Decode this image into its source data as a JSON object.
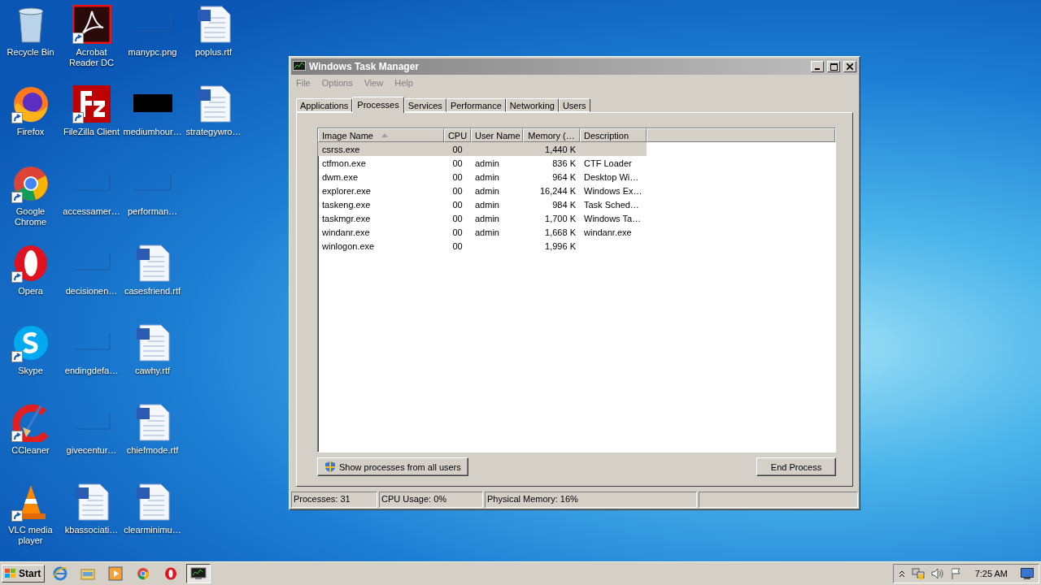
{
  "desktop": {
    "icons": [
      {
        "label": "Recycle Bin",
        "kind": "recycle",
        "shortcut": false
      },
      {
        "label": "Firefox",
        "kind": "firefox",
        "shortcut": true
      },
      {
        "label": "Google Chrome",
        "kind": "chrome",
        "shortcut": true
      },
      {
        "label": "Opera",
        "kind": "opera",
        "shortcut": true
      },
      {
        "label": "Skype",
        "kind": "skype",
        "shortcut": true
      },
      {
        "label": "CCleaner",
        "kind": "ccleaner",
        "shortcut": true
      },
      {
        "label": "VLC media player",
        "kind": "vlc",
        "shortcut": true
      },
      {
        "label": "Acrobat Reader DC",
        "kind": "acrobat",
        "shortcut": true
      },
      {
        "label": "FileZilla Client",
        "kind": "filezilla",
        "shortcut": true
      },
      {
        "label": "accessamer…",
        "kind": "blank",
        "shortcut": false
      },
      {
        "label": "decisionen…",
        "kind": "blank",
        "shortcut": false
      },
      {
        "label": "endingdefa…",
        "kind": "blank",
        "shortcut": false
      },
      {
        "label": "givecentur…",
        "kind": "blank",
        "shortcut": false
      },
      {
        "label": "kbassociati…",
        "kind": "word",
        "shortcut": false
      },
      {
        "label": "manypc.png",
        "kind": "blank",
        "shortcut": false
      },
      {
        "label": "mediumhour…",
        "kind": "black",
        "shortcut": false
      },
      {
        "label": "performan…",
        "kind": "blank",
        "shortcut": false
      },
      {
        "label": "casesfriend.rtf",
        "kind": "word",
        "shortcut": false
      },
      {
        "label": "cawhy.rtf",
        "kind": "word",
        "shortcut": false
      },
      {
        "label": "chiefmode.rtf",
        "kind": "word",
        "shortcut": false
      },
      {
        "label": "clearminimu…",
        "kind": "word",
        "shortcut": false
      },
      {
        "label": "poplus.rtf",
        "kind": "word",
        "shortcut": false
      },
      {
        "label": "strategywro…",
        "kind": "word",
        "shortcut": false
      }
    ]
  },
  "window": {
    "title": "Windows Task Manager",
    "menu": [
      "File",
      "Options",
      "View",
      "Help"
    ],
    "tabs": [
      {
        "label": "Applications",
        "selected": false
      },
      {
        "label": "Processes",
        "selected": true
      },
      {
        "label": "Services",
        "selected": false
      },
      {
        "label": "Performance",
        "selected": false
      },
      {
        "label": "Networking",
        "selected": false
      },
      {
        "label": "Users",
        "selected": false
      }
    ],
    "table": {
      "columns": [
        {
          "label": "Image Name",
          "sorted": true
        },
        {
          "label": "CPU",
          "sorted": false
        },
        {
          "label": "User Name",
          "sorted": false
        },
        {
          "label": "Memory (…",
          "sorted": false
        },
        {
          "label": "Description",
          "sorted": false
        }
      ],
      "rows": [
        {
          "image_name": "csrss.exe",
          "cpu": "00",
          "memory": "1,440 K",
          "selected": true
        },
        {
          "image_name": "ctfmon.exe",
          "cpu": "00",
          "user_name": "admin",
          "memory": "836 K",
          "description": "CTF Loader",
          "selected": false
        },
        {
          "image_name": "dwm.exe",
          "cpu": "00",
          "user_name": "admin",
          "memory": "964 K",
          "description": "Desktop Wi…",
          "selected": false
        },
        {
          "image_name": "explorer.exe",
          "cpu": "00",
          "user_name": "admin",
          "memory": "16,244 K",
          "description": "Windows Ex…",
          "selected": false
        },
        {
          "image_name": "taskeng.exe",
          "cpu": "00",
          "user_name": "admin",
          "memory": "984 K",
          "description": "Task Sched…",
          "selected": false
        },
        {
          "image_name": "taskmgr.exe",
          "cpu": "00",
          "user_name": "admin",
          "memory": "1,700 K",
          "description": "Windows Ta…",
          "selected": false
        },
        {
          "image_name": "windanr.exe",
          "cpu": "00",
          "user_name": "admin",
          "memory": "1,668 K",
          "description": "windanr.exe",
          "selected": false
        },
        {
          "image_name": "winlogon.exe",
          "cpu": "00",
          "memory": "1,996 K",
          "selected": false
        }
      ]
    },
    "show_all_button": "Show processes from all users",
    "end_button": "End Process",
    "status_bar": [
      "Processes: 31",
      "CPU Usage: 0%",
      "Physical Memory: 16%"
    ]
  },
  "taskbar": {
    "start": "Start",
    "apps": [
      {
        "kind": "ie",
        "active": false
      },
      {
        "kind": "explorer",
        "active": false
      },
      {
        "kind": "media",
        "active": false
      },
      {
        "kind": "chrome",
        "active": false
      },
      {
        "kind": "opera",
        "active": false
      },
      {
        "kind": "taskmgr",
        "active": true
      }
    ],
    "clock": "7:25 AM"
  }
}
